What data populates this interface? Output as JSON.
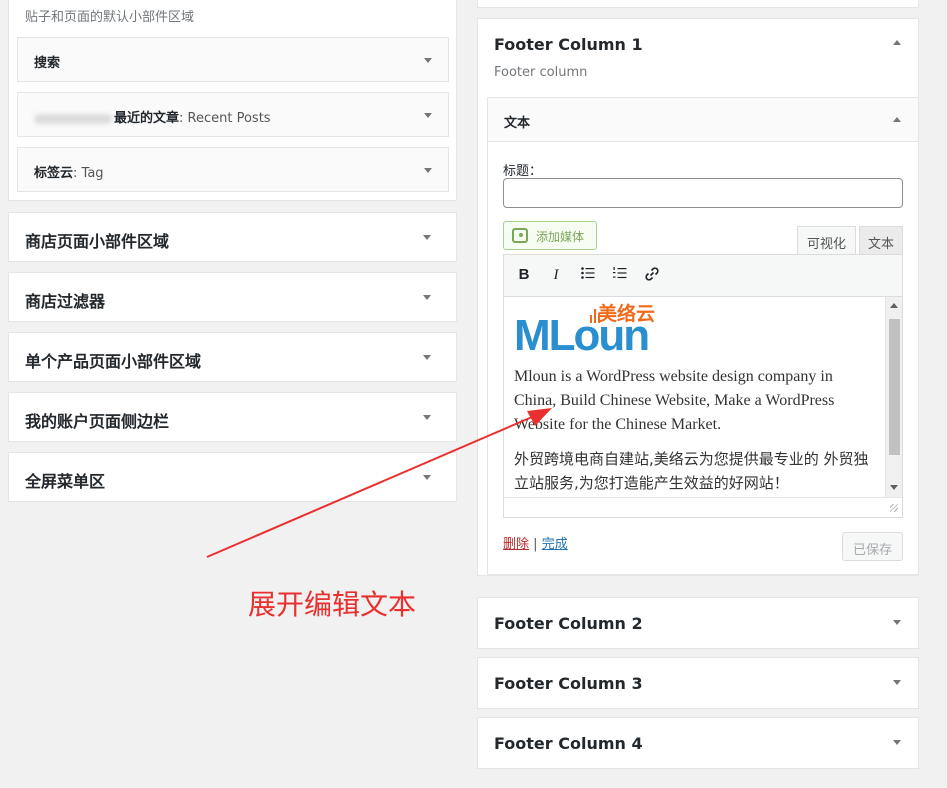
{
  "left": {
    "top_area": {
      "description": "贴子和页面的默认小部件区域",
      "widgets": [
        {
          "label": "搜索",
          "suffix": ""
        },
        {
          "label": "最近的文章",
          "suffix": ": Recent Posts"
        },
        {
          "label": "标签云",
          "suffix": ": Tag"
        }
      ]
    },
    "areas": [
      {
        "title": "商店页面小部件区域"
      },
      {
        "title": "商店过滤器"
      },
      {
        "title": "单个产品页面小部件区域"
      },
      {
        "title": "我的账户页面侧边栏"
      },
      {
        "title": "全屏菜单区"
      }
    ]
  },
  "right": {
    "footer1": {
      "title": "Footer Column 1",
      "description": "Footer column",
      "text_widget": {
        "title": "文本",
        "title_label": "标题：",
        "title_value": "",
        "add_media": "添加媒体",
        "tab_visual": "可视化",
        "tab_text": "文本",
        "toolbar": {
          "bold": "B",
          "italic": "I"
        },
        "logo_text": "MLoun",
        "logo_cn": "美络云",
        "paragraph1": "Mloun is a WordPress website design company in China, Build Chinese Website, Make a WordPress Website for the Chinese Market.",
        "paragraph2": "外贸跨境电商自建站,美络云为您提供最专业的 外贸独立站服务,为您打造能产生效益的好网站！",
        "delete": "删除",
        "separator": "|",
        "done": "完成",
        "saved": "已保存"
      }
    },
    "footer_others": [
      {
        "title": "Footer Column 2"
      },
      {
        "title": "Footer Column 3"
      },
      {
        "title": "Footer Column 4"
      }
    ]
  },
  "annotation": {
    "text": "展开编辑文本",
    "color": "#e8312f"
  },
  "colors": {
    "background": "#f1f1f1",
    "link": "#2271b1",
    "delete": "#b32d2e",
    "media": "#7aa756",
    "logo_blue": "#2a8fcf",
    "logo_orange": "#ef6b1c"
  }
}
